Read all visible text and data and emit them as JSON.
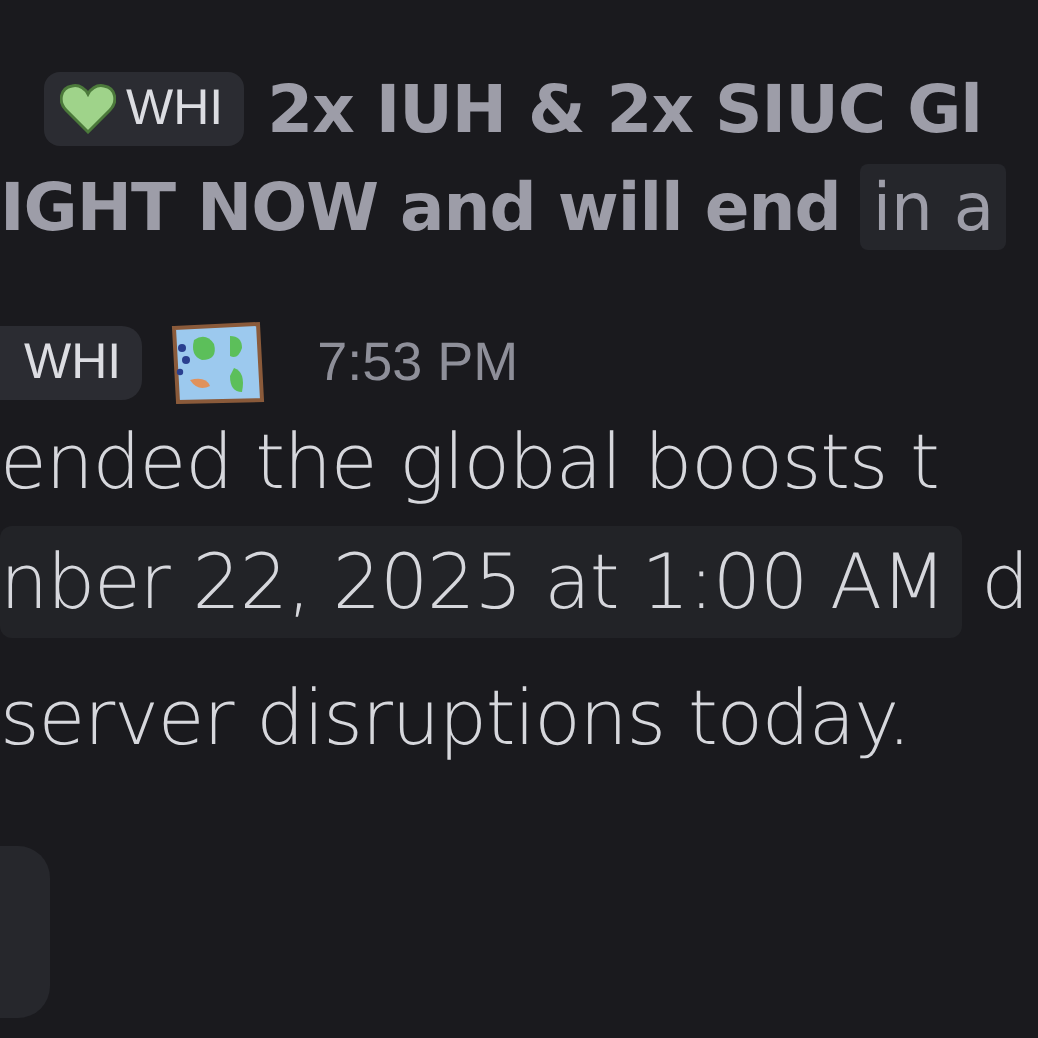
{
  "previous_message": {
    "role_tag": {
      "label": "WHI"
    },
    "lines": [
      [
        {
          "kind": "bold",
          "text": "2x IUH & 2x SIUC Gl"
        }
      ],
      [
        {
          "kind": "bold",
          "text": "IGHT NOW and will end"
        },
        {
          "kind": "timestamp",
          "text": "in a"
        }
      ]
    ]
  },
  "message": {
    "role_tag": {
      "label": "WHI"
    },
    "time": "7:53 PM",
    "lines": [
      [
        {
          "kind": "plain",
          "text": "ended the global boosts t"
        }
      ],
      [
        {
          "kind": "timestamp",
          "text": "nber 22, 2025 at 1:00 AM"
        },
        {
          "kind": "plain",
          "text": "d"
        }
      ],
      [
        {
          "kind": "plain",
          "text": "server disruptions today."
        }
      ]
    ]
  },
  "reactions": [
    {
      "kind": "emoji_reaction"
    }
  ]
}
